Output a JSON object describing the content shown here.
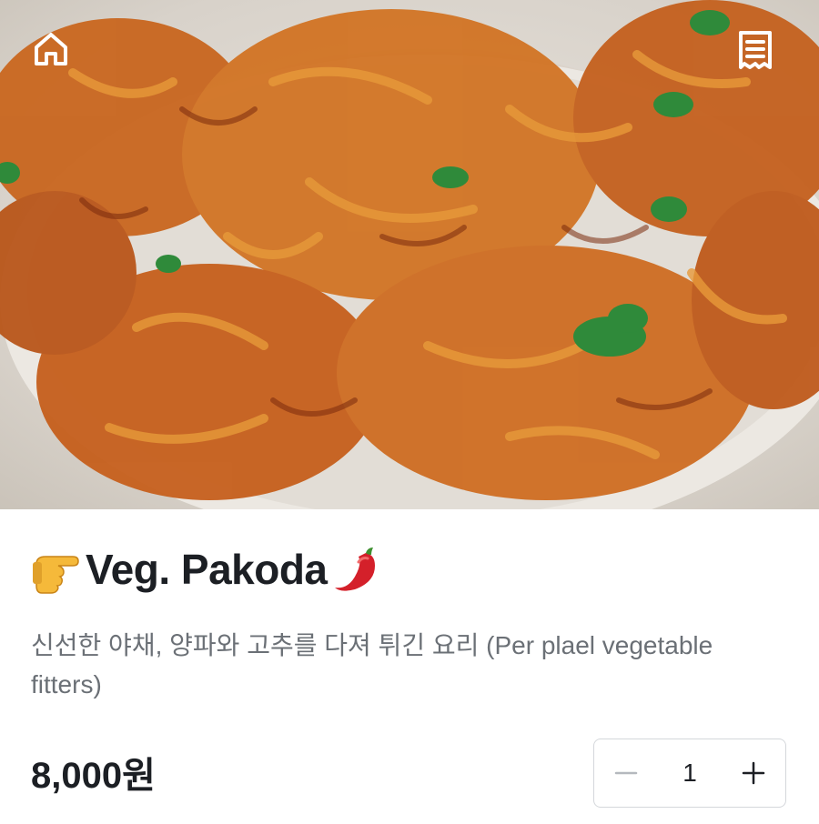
{
  "header": {
    "home_icon": "home-icon",
    "receipt_icon": "receipt-icon"
  },
  "hero_image": {
    "subject": "plate of fried vegetable pakoda with cilantro leaves"
  },
  "product": {
    "title_prefix_emoji": "pointing-hand-emoji",
    "title": "Veg. Pakoda",
    "title_suffix_emoji": "chili-pepper-emoji",
    "description": "신선한 야채, 양파와 고추를 다져 튀긴 요리 (Per plael vegetable fitters)",
    "price": "8,000원"
  },
  "quantity_stepper": {
    "decrement_icon": "minus-icon",
    "value": "1",
    "increment_icon": "plus-icon"
  },
  "colors": {
    "text_primary": "#1c1f24",
    "text_secondary": "#6b7076",
    "stepper_border": "#d4d7db",
    "decrement_disabled": "#b5b9be"
  }
}
